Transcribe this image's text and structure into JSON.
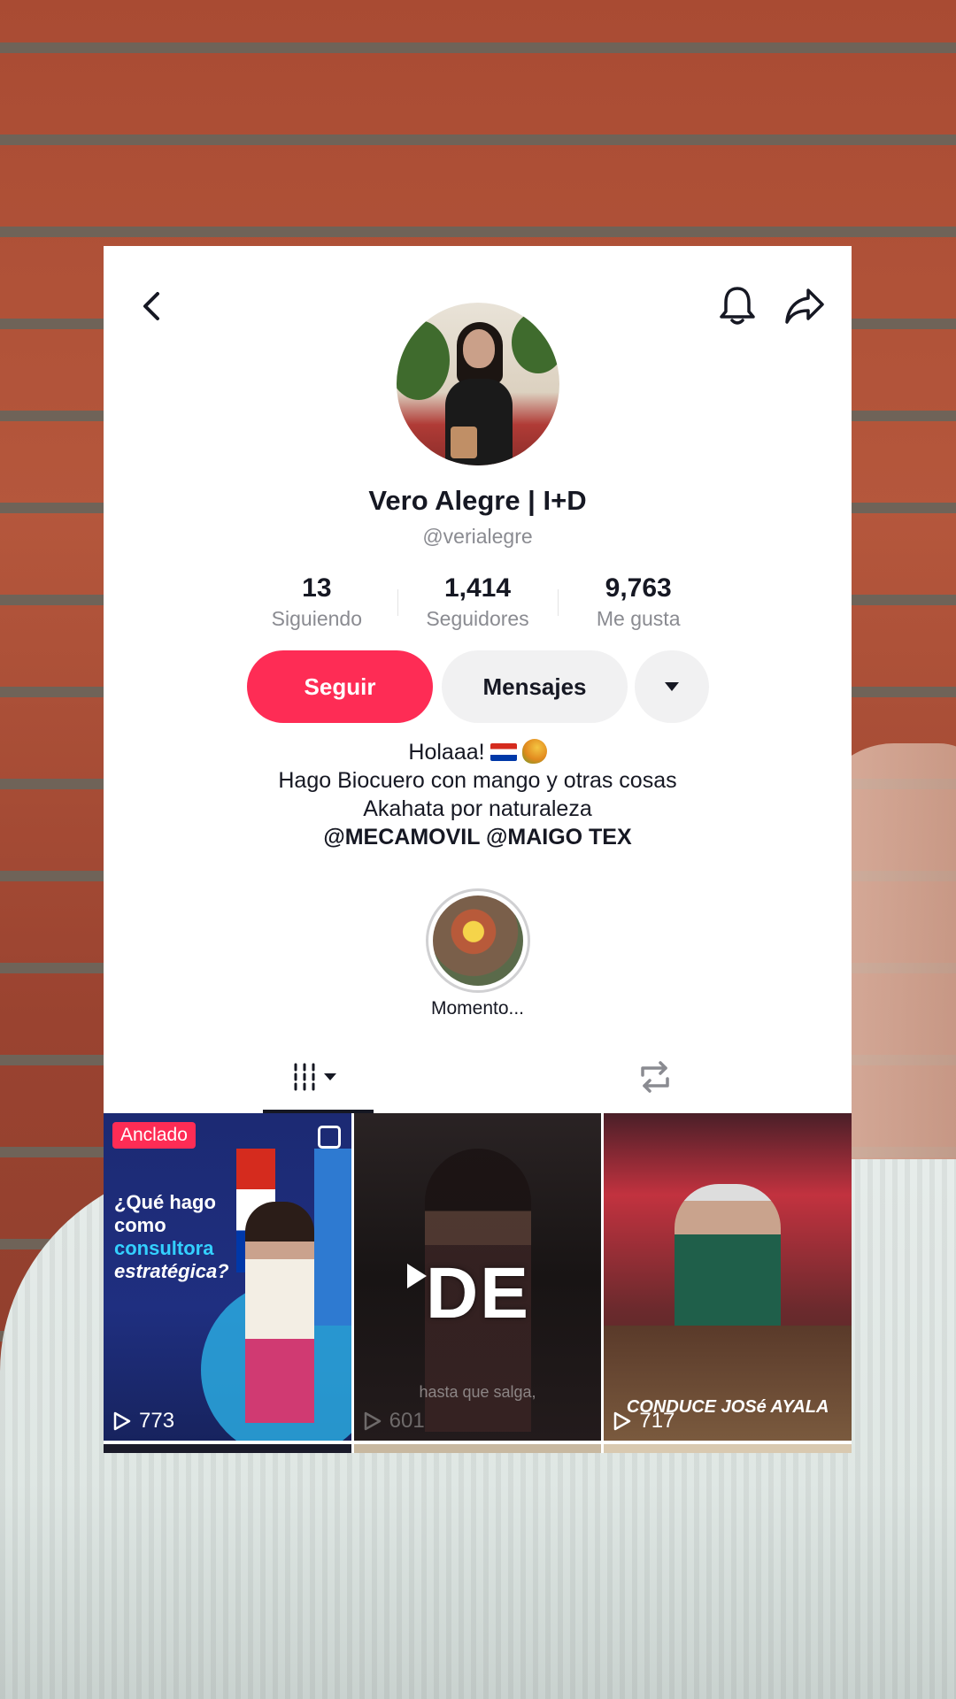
{
  "profile": {
    "name": "Vero Alegre | I+D",
    "handle": "@verialegre",
    "stats": [
      {
        "value": "13",
        "label": "Siguiendo"
      },
      {
        "value": "1,414",
        "label": "Seguidores"
      },
      {
        "value": "9,763",
        "label": "Me gusta"
      }
    ],
    "buttons": {
      "follow": "Seguir",
      "message": "Mensajes"
    },
    "bio": {
      "line1": "Holaaa!",
      "line2": "Hago Biocuero con mango y otras cosas",
      "line3": "Akahata por naturaleza",
      "links": "@MECAMOVIL @MAIGO TEX"
    },
    "highlight_label": "Momento..."
  },
  "videos": [
    {
      "badge": "Anclado",
      "heading_a": "¿Qué hago",
      "heading_b": "como",
      "heading_c": "consultora",
      "heading_d": "estratégica?",
      "views": "773"
    },
    {
      "subtitle": "hasta que salga,",
      "views": "601"
    },
    {
      "caption": "CONDUCE JOSé AYALA",
      "views": "717"
    }
  ],
  "overlay_caption": "DE",
  "colors": {
    "accent": "#fe2c55",
    "text": "#161823",
    "muted": "#8a8b91"
  }
}
